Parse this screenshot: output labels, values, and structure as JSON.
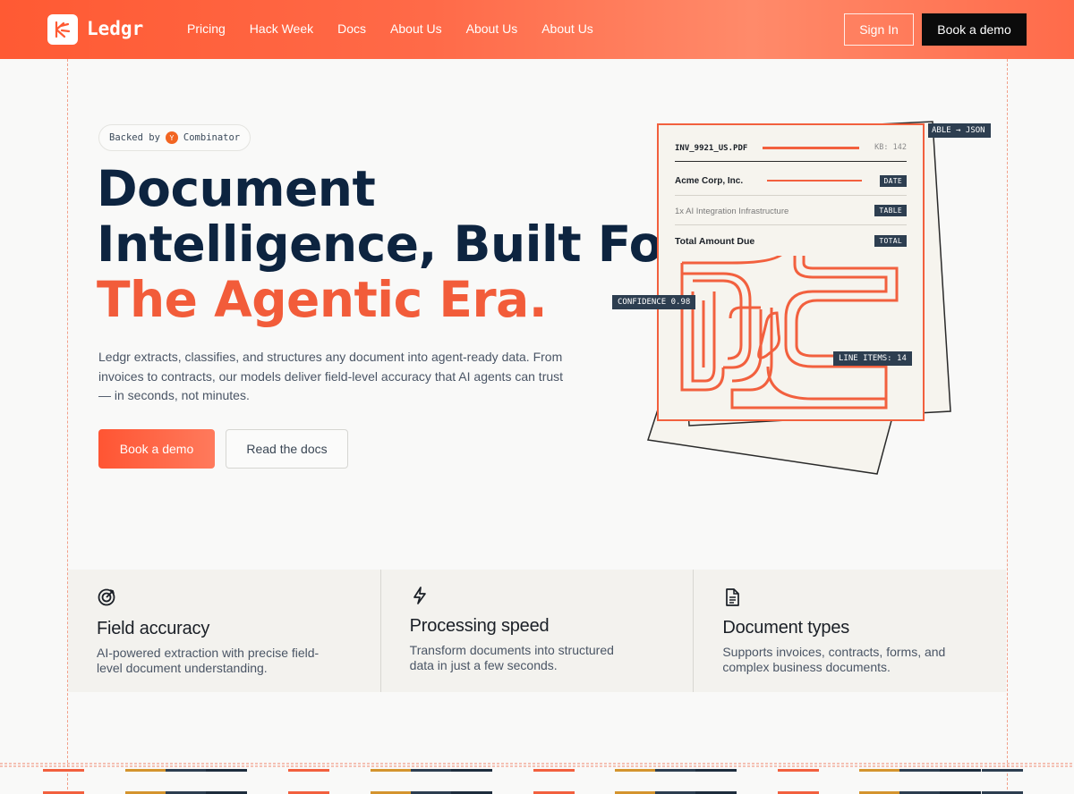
{
  "header": {
    "logo_text": "Ledgr",
    "nav": [
      "Pricing",
      "Hack Week",
      "Docs",
      "About Us",
      "About Us",
      "About Us"
    ],
    "signin_label": "Sign In",
    "book_demo_label": "Book a demo"
  },
  "hero": {
    "badge_prefix": "Backed by",
    "badge_logo": "Y",
    "badge_suffix": "Combinator",
    "headline_line1": "Document",
    "headline_line2": "Intelligence, Built For",
    "headline_accent": "The Agentic Era.",
    "description": "Ledgr extracts, classifies, and structures any document into agent-ready data. From invoices to contracts, our models deliver field-level accuracy that AI agents can trust — in seconds, not minutes.",
    "primary_cta": "Book a demo",
    "secondary_cta": "Read the docs"
  },
  "illustration": {
    "filename": "INV_9921_US.PDF",
    "kb": "KB: 142",
    "company": "Acme Corp, Inc.",
    "line_item": "1x AI Integration Infrastructure",
    "total_label": "Total Amount Due",
    "tag_date": "DATE",
    "tag_table": "TABLE",
    "tag_total": "TOTAL",
    "float_table_json": "ABLE → JSON",
    "float_confidence": "CONFIDENCE 0.98",
    "float_line_items": "LINE ITEMS: 14"
  },
  "features": [
    {
      "icon": "target-icon",
      "title": "Field accuracy",
      "desc": "AI-powered extraction with precise field-level document understanding."
    },
    {
      "icon": "lightning-icon",
      "title": "Processing speed",
      "desc": "Transform documents into structured data in just a few seconds."
    },
    {
      "icon": "document-icon",
      "title": "Document types",
      "desc": "Supports invoices, contracts, forms, and complex business documents."
    }
  ],
  "colors": {
    "accent": "#f25c3a",
    "navy": "#0d2440",
    "tag_bg": "#2d3e50"
  }
}
